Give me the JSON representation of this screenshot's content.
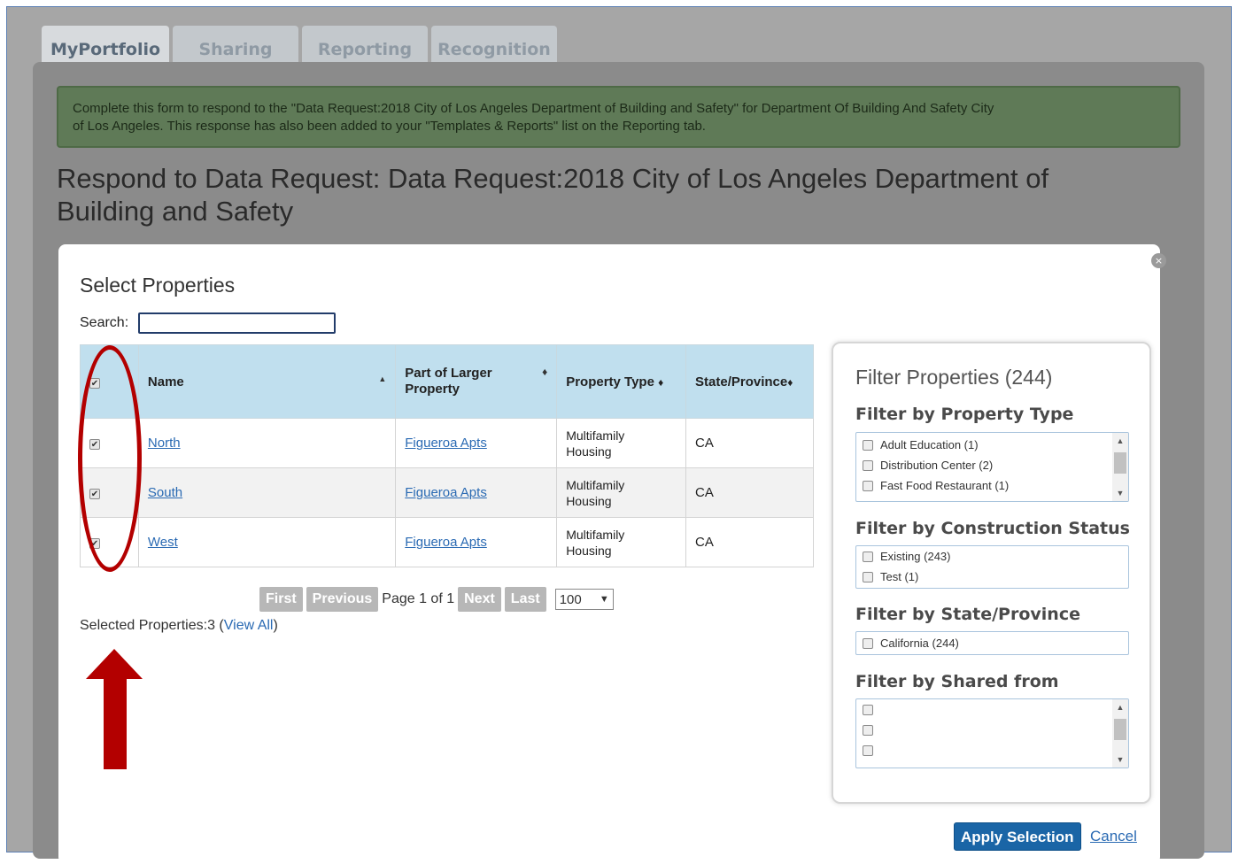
{
  "tabs": [
    {
      "label": "MyPortfolio",
      "active": true
    },
    {
      "label": "Sharing",
      "active": false
    },
    {
      "label": "Reporting",
      "active": false
    },
    {
      "label": "Recognition",
      "active": false
    }
  ],
  "notice": {
    "line1": "Complete this form to respond to the \"Data Request:2018 City of Los Angeles Department of Building and Safety\" for Department Of Building And Safety City",
    "line2": "of Los Angeles. This response has also been added to your \"Templates & Reports\" list on the Reporting tab."
  },
  "page_title": {
    "line1": "Respond to Data Request: Data Request:2018 City of Los Angeles Department of",
    "line2": "Building and Safety"
  },
  "modal": {
    "title": "Select Properties",
    "close_glyph": "×",
    "search": {
      "label": "Search:",
      "value": ""
    },
    "table": {
      "columns": [
        "Name",
        "Part of Larger Property",
        "Property Type",
        "State/Province"
      ],
      "sort_glyph_asc": "▲",
      "sort_glyph_both": "♦",
      "rows": [
        {
          "checked": true,
          "name": "North",
          "parent": "Figueroa Apts",
          "type_line1": "Multifamily",
          "type_line2": "Housing",
          "state": "CA"
        },
        {
          "checked": true,
          "name": "South",
          "parent": "Figueroa Apts",
          "type_line1": "Multifamily",
          "type_line2": "Housing",
          "state": "CA"
        },
        {
          "checked": true,
          "name": "West",
          "parent": "Figueroa Apts",
          "type_line1": "Multifamily",
          "type_line2": "Housing",
          "state": "CA"
        }
      ]
    },
    "pager": {
      "first": "First",
      "previous": "Previous",
      "page_text": "Page 1 of 1",
      "next": "Next",
      "last": "Last",
      "page_size": "100",
      "page_size_glyph": "▼"
    },
    "selected": {
      "text": "Selected Properties:3 (",
      "link": "View All",
      "close": ")"
    },
    "filter": {
      "title": "Filter Properties (244)",
      "property_type": {
        "heading": "Filter by Property Type",
        "items": [
          "Adult Education (1)",
          "Distribution Center (2)",
          "Fast Food Restaurant (1)"
        ]
      },
      "construction_status": {
        "heading": "Filter by Construction Status",
        "items": [
          "Existing (243)",
          "Test (1)"
        ]
      },
      "state_province": {
        "heading": "Filter by State/Province",
        "items": [
          "California (244)"
        ]
      },
      "shared_from": {
        "heading": "Filter by Shared from",
        "items": [
          "",
          "",
          ""
        ]
      }
    },
    "apply_label": "Apply Selection",
    "cancel_label": "Cancel"
  },
  "annotation_color": "#b30000"
}
